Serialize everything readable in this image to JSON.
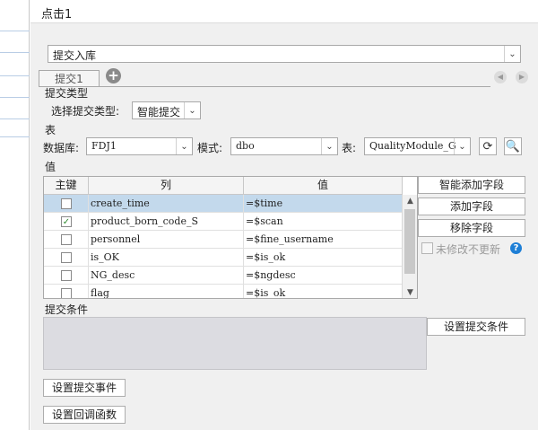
{
  "header": {
    "title": "点击1"
  },
  "action_select": {
    "value": "提交入库"
  },
  "tabs": [
    {
      "label": "提交1"
    }
  ],
  "submit_type": {
    "section_label": "提交类型",
    "choose_label": "选择提交类型:",
    "value": "智能提交"
  },
  "table_section": {
    "section_label": "表",
    "database_label": "数据库:",
    "database_value": "FDJ1",
    "schema_label": "模式:",
    "schema_value": "dbo",
    "table_label": "表:",
    "table_value": "QualityModule_G"
  },
  "values_section": {
    "section_label": "值",
    "columns": {
      "key": "主键",
      "column": "列",
      "value": "值"
    },
    "rows": [
      {
        "checked": false,
        "column": "create_time",
        "value": "=$time"
      },
      {
        "checked": true,
        "column": "product_born_code_S",
        "value": "=$scan"
      },
      {
        "checked": false,
        "column": "personnel",
        "value": "=$fine_username"
      },
      {
        "checked": false,
        "column": "is_OK",
        "value": "=$is_ok"
      },
      {
        "checked": false,
        "column": "NG_desc",
        "value": "=$ngdesc"
      },
      {
        "checked": false,
        "column": "flag",
        "value": "=$is_ok"
      }
    ],
    "smart_add_label": "智能添加字段",
    "add_label": "添加字段",
    "remove_label": "移除字段",
    "no_update_label": "未修改不更新"
  },
  "condition_section": {
    "section_label": "提交条件",
    "set_condition_label": "设置提交条件"
  },
  "set_event_label": "设置提交事件",
  "set_callback_label": "设置回调函数",
  "colors": {
    "selected_row": "#c3d9ec",
    "help_icon": "#1e7fd6"
  }
}
